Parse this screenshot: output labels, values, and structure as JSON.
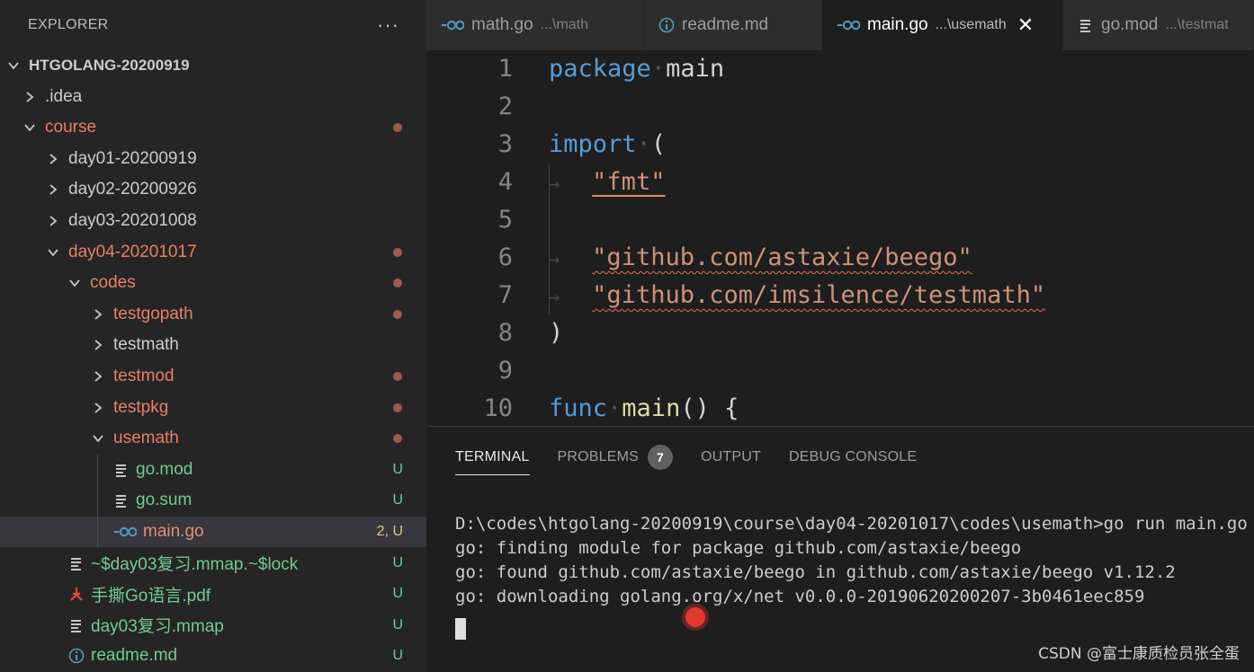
{
  "sidebar": {
    "title": "EXPLORER",
    "more_icon": "···",
    "tree": [
      {
        "label": "HTGOLANG-20200919",
        "depth": 0,
        "chevron": "down",
        "kind": "root",
        "color": "normal",
        "badge": ""
      },
      {
        "label": ".idea",
        "depth": 1,
        "chevron": "right",
        "kind": "folder",
        "color": "normal",
        "badge": ""
      },
      {
        "label": "course",
        "depth": 1,
        "chevron": "down",
        "kind": "folder",
        "color": "red",
        "badge": "dot"
      },
      {
        "label": "day01-20200919",
        "depth": 2,
        "chevron": "right",
        "kind": "folder",
        "color": "normal",
        "badge": ""
      },
      {
        "label": "day02-20200926",
        "depth": 2,
        "chevron": "right",
        "kind": "folder",
        "color": "normal",
        "badge": ""
      },
      {
        "label": "day03-20201008",
        "depth": 2,
        "chevron": "right",
        "kind": "folder",
        "color": "normal",
        "badge": ""
      },
      {
        "label": "day04-20201017",
        "depth": 2,
        "chevron": "down",
        "kind": "folder",
        "color": "red",
        "badge": "dot"
      },
      {
        "label": "codes",
        "depth": 3,
        "chevron": "down",
        "kind": "folder",
        "color": "red",
        "badge": "dot"
      },
      {
        "label": "testgopath",
        "depth": 4,
        "chevron": "right",
        "kind": "folder",
        "color": "red",
        "badge": "dot"
      },
      {
        "label": "testmath",
        "depth": 4,
        "chevron": "right",
        "kind": "folder",
        "color": "normal",
        "badge": ""
      },
      {
        "label": "testmod",
        "depth": 4,
        "chevron": "right",
        "kind": "folder",
        "color": "red",
        "badge": "dot"
      },
      {
        "label": "testpkg",
        "depth": 4,
        "chevron": "right",
        "kind": "folder",
        "color": "red",
        "badge": "dot"
      },
      {
        "label": "usemath",
        "depth": 4,
        "chevron": "down",
        "kind": "folder",
        "color": "red",
        "badge": "dot"
      },
      {
        "label": "go.mod",
        "depth": 5,
        "chevron": "",
        "kind": "lines",
        "color": "green",
        "badge": "U"
      },
      {
        "label": "go.sum",
        "depth": 5,
        "chevron": "",
        "kind": "lines",
        "color": "green",
        "badge": "U"
      },
      {
        "label": "main.go",
        "depth": 5,
        "chevron": "",
        "kind": "go",
        "color": "orange",
        "badge": "2, U",
        "selected": true
      },
      {
        "label": "~$day03复习.mmap.~$lock",
        "depth": 3,
        "chevron": "",
        "kind": "lines",
        "color": "green",
        "badge": "U"
      },
      {
        "label": "手撕Go语言.pdf",
        "depth": 3,
        "chevron": "",
        "kind": "pdf",
        "color": "green",
        "badge": "U"
      },
      {
        "label": "day03复习.mmap",
        "depth": 3,
        "chevron": "",
        "kind": "lines",
        "color": "green",
        "badge": "U"
      },
      {
        "label": "readme.md",
        "depth": 3,
        "chevron": "",
        "kind": "info",
        "color": "green",
        "badge": "U"
      }
    ]
  },
  "tabs": [
    {
      "icon": "go",
      "label": "math.go",
      "desc": "...\\math",
      "active": false
    },
    {
      "icon": "info",
      "label": "readme.md",
      "desc": "",
      "active": false
    },
    {
      "icon": "go",
      "label": "main.go",
      "desc": "...\\usemath",
      "active": true
    },
    {
      "icon": "lines",
      "label": "go.mod",
      "desc": "...\\testmat",
      "active": false
    }
  ],
  "editor": {
    "line_numbers": [
      "1",
      "2",
      "3",
      "4",
      "5",
      "6",
      "7",
      "8",
      "9",
      "10"
    ],
    "lines": {
      "l1_kw": "package",
      "l1_name": "main",
      "l3_kw": "import",
      "l3_paren": "(",
      "l4_str": "\"fmt\"",
      "l6_str": "\"github.com/astaxie/beego\"",
      "l7_str": "\"github.com/imsilence/testmath\"",
      "l8_paren": ")",
      "l10_kw": "func",
      "l10_name": "main",
      "l10_rest": "() {"
    }
  },
  "panel": {
    "tabs": [
      {
        "label": "TERMINAL",
        "active": true
      },
      {
        "label": "PROBLEMS",
        "count": "7"
      },
      {
        "label": "OUTPUT"
      },
      {
        "label": "DEBUG CONSOLE"
      }
    ],
    "terminal_lines": [
      "D:\\codes\\htgolang-20200919\\course\\day04-20201017\\codes\\usemath>go run main.go",
      "go: finding module for package github.com/astaxie/beego",
      "go: found github.com/astaxie/beego in github.com/astaxie/beego v1.12.2",
      "go: downloading golang.org/x/net v0.0.0-20190620200207-3b0461eec859"
    ]
  },
  "watermark": "CSDN @富士康质检员张全蛋"
}
